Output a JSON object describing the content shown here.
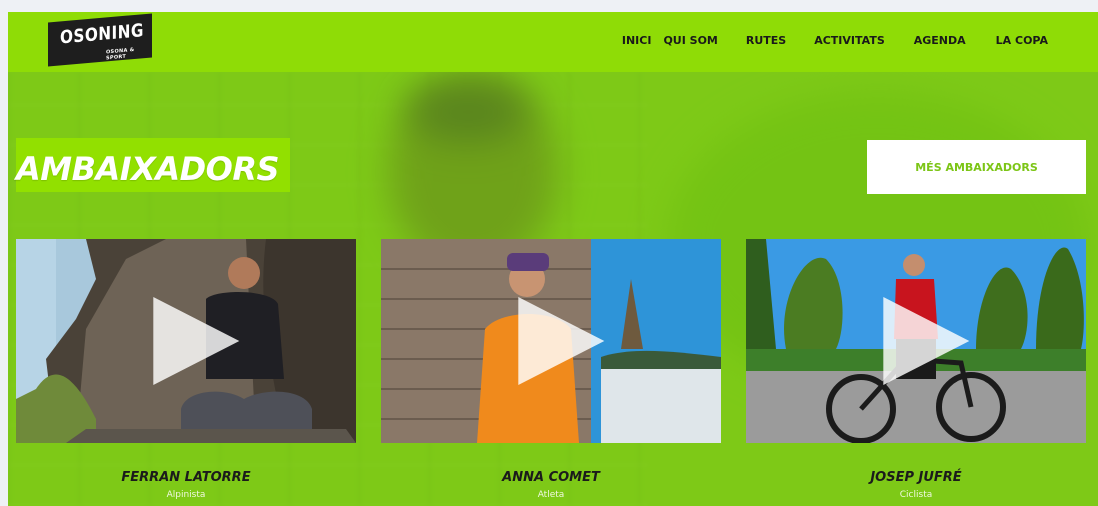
{
  "logo": {
    "text": "OSONING",
    "tagline": "OSONA & SPORT"
  },
  "nav": {
    "items": [
      {
        "label": "INICI"
      },
      {
        "label": "QUI SOM"
      },
      {
        "label": "RUTES"
      },
      {
        "label": "ACTIVITATS"
      },
      {
        "label": "AGENDA"
      },
      {
        "label": "LA COPA"
      }
    ]
  },
  "section": {
    "title": "AMBAIXADORS",
    "more_button": "MÉS AMBAIXADORS"
  },
  "ambassadors": [
    {
      "name": "FERRAN LATORRE",
      "role": "Alpinista"
    },
    {
      "name": "ANNA COMET",
      "role": "Atleta"
    },
    {
      "name": "JOSEP JUFRÉ",
      "role": "Ciclista"
    }
  ],
  "colors": {
    "brand_green": "#8fdc06",
    "background_green": "#7ac21c",
    "logo_dark": "#1e1e1e"
  },
  "icons": {
    "video_play": "play-icon"
  }
}
